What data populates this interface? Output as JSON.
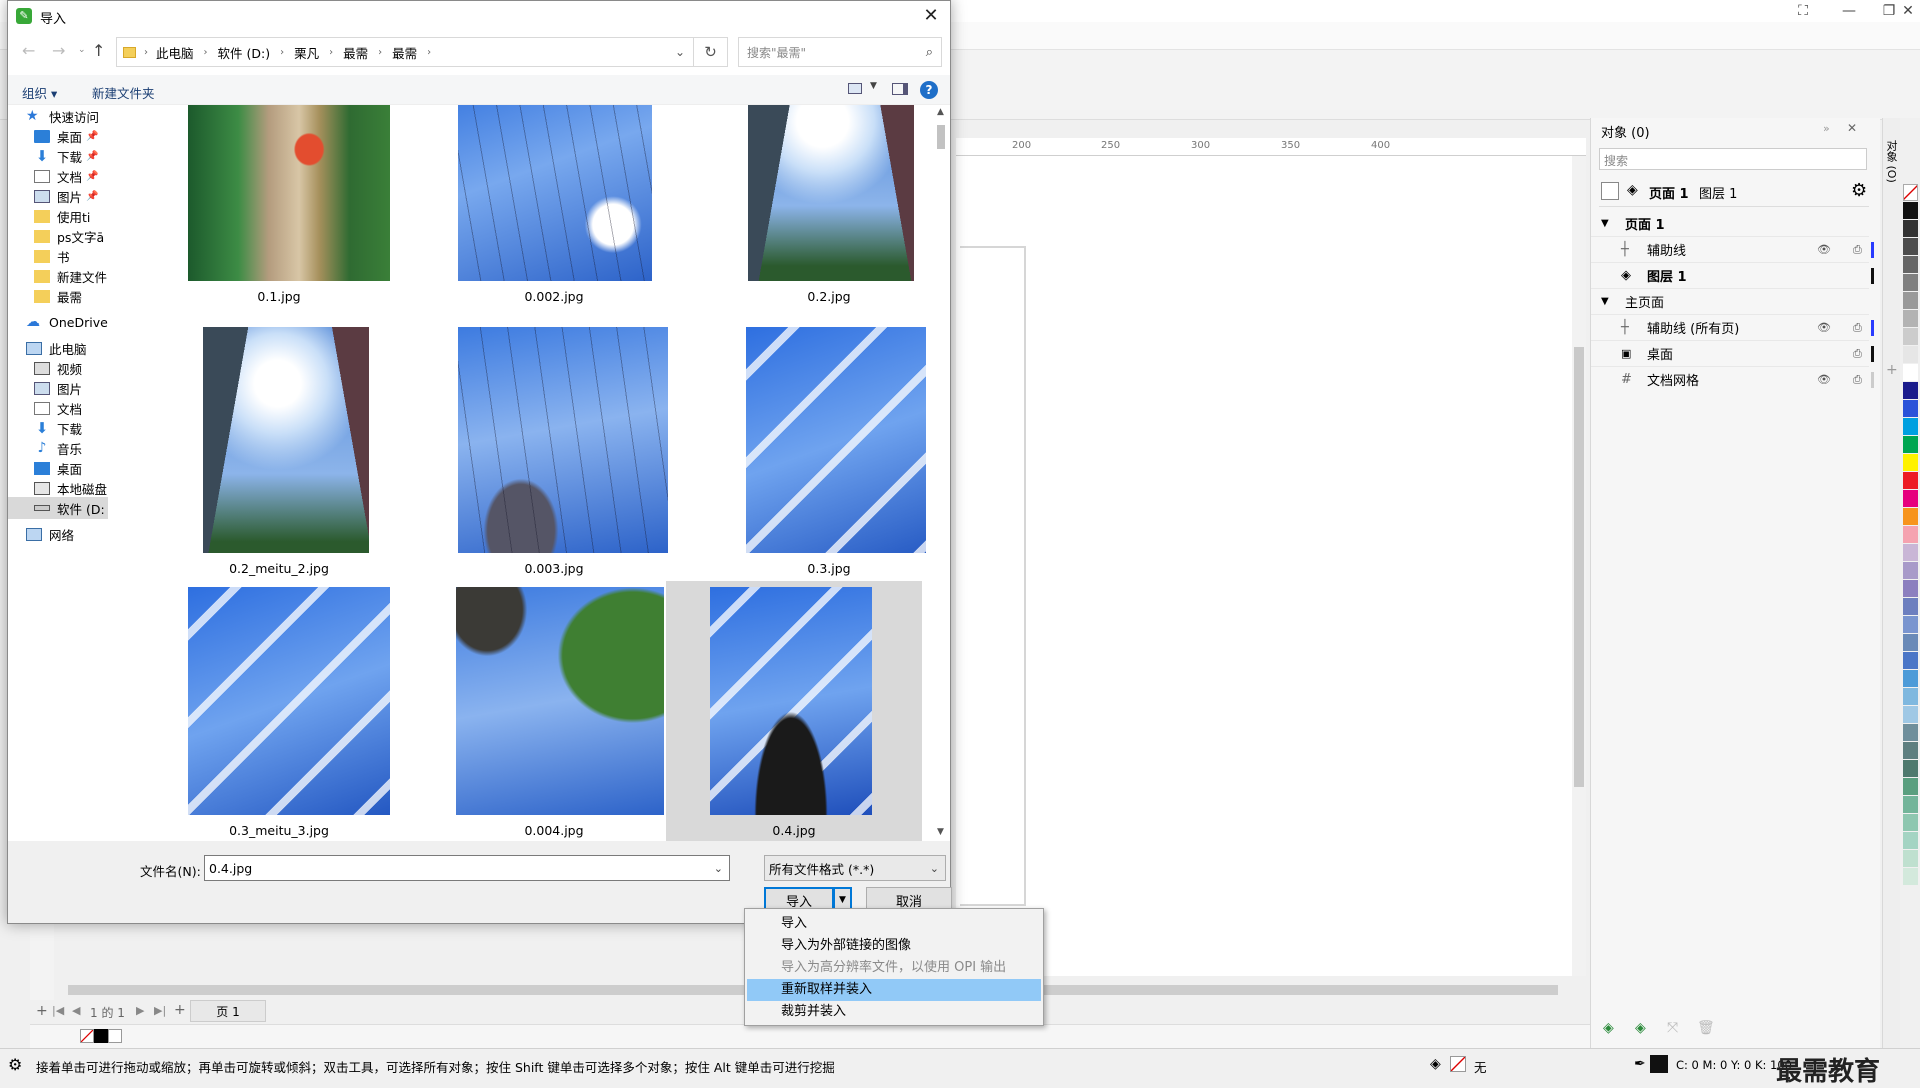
{
  "dialog": {
    "title": "导入",
    "close": "✕",
    "breadcrumb": [
      "此电脑",
      "软件 (D:)",
      "栗凡",
      "最需",
      "最需"
    ],
    "search_placeholder": "搜索\"最需\"",
    "cmd": {
      "organize": "组织",
      "new_folder": "新建文件夹"
    },
    "nav": {
      "quick_access": "快速访问",
      "quick_items": [
        "桌面",
        "下载",
        "文档",
        "图片",
        "使用ti",
        "ps文字ā",
        "书",
        "新建文件",
        "最需"
      ],
      "onedrive": "OneDrive",
      "this_pc": "此电脑",
      "pc_items": [
        "视频",
        "图片",
        "文档",
        "下载",
        "音乐",
        "桌面",
        "本地磁盘",
        "软件 (D:"
      ],
      "network": "网络"
    },
    "files": [
      "0.1.jpg",
      "0.002.jpg",
      "0.2.jpg",
      "0.2_meitu_2.jpg",
      "0.003.jpg",
      "0.3.jpg",
      "0.3_meitu_3.jpg",
      "0.004.jpg",
      "0.4.jpg"
    ],
    "filename_label": "文件名(N):",
    "filename_value": "0.4.jpg",
    "filetype": "所有文件格式 (*.*)",
    "import_button": "导入",
    "cancel_button": "取消",
    "import_menu": [
      "导入",
      "导入为外部链接的图像",
      "导入为高分辨率文件，以使用 OPI 输出",
      "重新取样并装入",
      "裁剪并装入"
    ]
  },
  "docker": {
    "title": "对象 (0)",
    "search_placeholder": "搜索",
    "page_label": "页面 1",
    "layer_label": "图层 1",
    "tree": [
      {
        "label": "页面 1",
        "level": 0
      },
      {
        "label": "辅助线",
        "level": 1
      },
      {
        "label": "图层 1",
        "level": 1
      },
      {
        "label": "主页面",
        "level": 0
      },
      {
        "label": "辅助线 (所有页)",
        "level": 1
      },
      {
        "label": "桌面",
        "level": 1
      },
      {
        "label": "文档网格",
        "level": 1
      }
    ],
    "side_tab": "对象 (O)"
  },
  "ruler": [
    "200",
    "250",
    "300",
    "350",
    "400"
  ],
  "pagebar": {
    "page_count": "1 的 1",
    "page_tab": "页 1"
  },
  "status": {
    "hint": "接着单击可进行拖动或缩放；再单击可旋转或倾斜；双击工具，可选择所有对象；按住 Shift 键单击可选择多个对象；按住 Alt 键单击可进行挖掘",
    "fill_none": "无",
    "cmyk": "C: 0 M: 0 Y: 0 K: 100",
    "watermark": "最需教育"
  },
  "colors": {
    "accent": "#0078d7",
    "selection": "#cce8ff",
    "menu_highlight": "#91c9f7"
  }
}
